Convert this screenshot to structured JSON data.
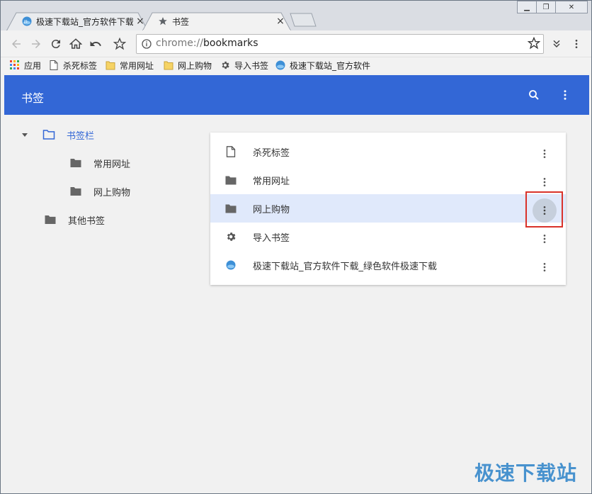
{
  "window": {
    "tabs": [
      {
        "title": "极速下载站_官方软件下载",
        "favicon": "globe-logo-icon",
        "active": false
      },
      {
        "title": "书签",
        "favicon": "star-icon",
        "active": true
      }
    ],
    "controls": {
      "minimize": "minimize-icon",
      "restore": "restore-icon",
      "close": "close-icon"
    }
  },
  "toolbar": {
    "url_scheme": "chrome://",
    "url_path": "bookmarks",
    "icons": [
      "back-arrow-icon",
      "forward-arrow-icon",
      "reload-icon",
      "home-icon",
      "undo-icon",
      "star-icon",
      "info-icon",
      "extensions-icon",
      "menu-icon"
    ]
  },
  "bookmarks_bar": [
    {
      "label": "应用",
      "icon": "apps-grid-icon"
    },
    {
      "label": "杀死标签",
      "icon": "page-icon"
    },
    {
      "label": "常用网址",
      "icon": "folder-icon"
    },
    {
      "label": "网上购物",
      "icon": "folder-icon"
    },
    {
      "label": "导入书签",
      "icon": "gear-icon"
    },
    {
      "label": "极速下载站_官方软件",
      "icon": "globe-logo-icon"
    }
  ],
  "header": {
    "title": "书签",
    "icons": [
      "search-icon",
      "more-vert-icon"
    ]
  },
  "tree": {
    "root": {
      "label": "书签栏",
      "expanded": true
    },
    "children": [
      {
        "label": "常用网址"
      },
      {
        "label": "网上购物"
      }
    ],
    "other": {
      "label": "其他书签"
    }
  },
  "list": [
    {
      "label": "杀死标签",
      "icon": "page-icon",
      "selected": false
    },
    {
      "label": "常用网址",
      "icon": "folder-icon",
      "selected": false
    },
    {
      "label": "网上购物",
      "icon": "folder-icon",
      "selected": true
    },
    {
      "label": "导入书签",
      "icon": "gear-icon",
      "selected": false
    },
    {
      "label": "极速下载站_官方软件下载_绿色软件极速下载",
      "icon": "globe-logo-icon",
      "selected": false
    }
  ],
  "watermark": "极速下载站",
  "colors": {
    "header": "#3367d6",
    "selected_row": "#e0e9fb",
    "highlight_box": "#d9322a",
    "tree_active": "#3367d6"
  }
}
